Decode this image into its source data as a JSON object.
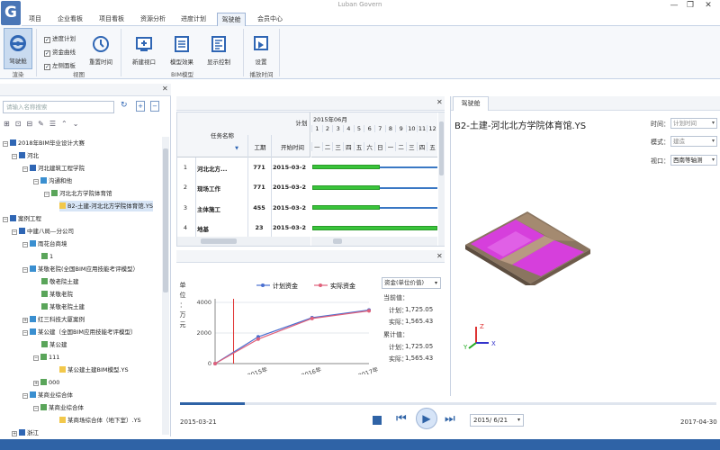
{
  "window": {
    "title": "Luban Govern",
    "controls": [
      "—",
      "❐",
      "✕"
    ]
  },
  "menu": {
    "tabs": [
      "项目",
      "企业看板",
      "项目看板",
      "资源分析",
      "进度计划",
      "驾驶舱",
      "会员中心"
    ],
    "active_index": 5
  },
  "ribbon": {
    "cockpit_label": "驾驶舱",
    "check_items": [
      "进度计划",
      "资金曲线",
      "左侧面板"
    ],
    "reset_time": "重置时间",
    "new_view": "新建视口",
    "model_effect": "模型效果",
    "display_control": "显示控制",
    "settings": "设置",
    "groups": [
      "渲染",
      "视图",
      "BIM模型",
      "播放时间"
    ]
  },
  "left": {
    "search_placeholder": "请输入名称搜索",
    "tree": [
      "2018年BIM毕业设计大赛",
      "河北",
      "河北建筑工程学院",
      "沟通和他",
      "河北北方学院体育馆",
      "B2-土建-河北北方学院体育馆.YS",
      "案例工程",
      "中建八局—分公司",
      "雨花台商境",
      "1",
      "某敬老院(全国BIM应用技能考评模型）",
      "敬老院土建",
      "某敬老院",
      "某敬老院土建",
      "红三科技大厦案例",
      "某公建（全国BIM应用技能考评模型）",
      "某公建",
      "111",
      "某公建土建BIM模型.YS",
      "000",
      "某商业综合体",
      "某商业综合体",
      "某商场综合体（地下室）.YS",
      "浙江"
    ]
  },
  "gantt": {
    "col_task": "任务名称",
    "col_plan": "计划",
    "col_duration": "工期",
    "col_start": "开始时间",
    "month": "2015年06月",
    "day_numbers": [
      "1",
      "2",
      "3",
      "4",
      "5",
      "6",
      "7",
      "8",
      "9",
      "10",
      "11",
      "12"
    ],
    "weekday_labels": [
      "一",
      "二",
      "三",
      "四",
      "五",
      "六",
      "日",
      "一",
      "二",
      "三",
      "四",
      "五"
    ],
    "rows": [
      {
        "no": "1",
        "name": "河北北方...",
        "duration": "771",
        "start": "2015-03-2"
      },
      {
        "no": "2",
        "name": "现场工作",
        "duration": "771",
        "start": "2015-03-2"
      },
      {
        "no": "3",
        "name": "主体施工",
        "duration": "455",
        "start": "2015-03-2"
      },
      {
        "no": "4",
        "name": "地基",
        "duration": "23",
        "start": "2015-03-2"
      }
    ],
    "close": "✕"
  },
  "chart": {
    "ylabel_chars": [
      "单",
      "位",
      "：",
      "万",
      "元"
    ],
    "legend_plan": "计划资金",
    "legend_actual": "实际资金",
    "select": "资金(单位价值)",
    "current_label": "当前值：",
    "plan_label": "计划：",
    "actual_label": "实际：",
    "cum_label": "累计值：",
    "current_plan": "1,725.05",
    "current_actual": "1,565.43",
    "cum_plan": "1,725.05",
    "cum_actual": "1,565.43",
    "close": "✕"
  },
  "chart_data": {
    "type": "line",
    "x": [
      "2015年",
      "2016年",
      "2017年"
    ],
    "yticks": [
      "0",
      "2000",
      "4000"
    ],
    "ylim": [
      0,
      4000
    ],
    "series": [
      {
        "name": "计划资金",
        "color": "#4a6fd0",
        "values": [
          0,
          1750,
          3000,
          3500
        ]
      },
      {
        "name": "实际资金",
        "color": "#e0607a",
        "values": [
          0,
          1600,
          2950,
          3450
        ]
      }
    ],
    "point_positions": [
      0,
      0.28,
      0.63,
      1.0
    ],
    "marker": 0.12
  },
  "viewer": {
    "tab": "驾驶舱",
    "model_title": "B2-土建-河北北方学院体育馆.YS",
    "time_label": "时间：",
    "time_value": "计划时间",
    "mode_label": "模式：",
    "mode_value": "建造",
    "view_label": "视口：",
    "view_value": "西南等轴测",
    "axis_z": "Z",
    "axis_x": "X",
    "axis_y": "Y"
  },
  "player": {
    "start": "2015-03-21",
    "end": "2017-04-30",
    "current": "2015/ 6/21",
    "progress": 0.12
  }
}
